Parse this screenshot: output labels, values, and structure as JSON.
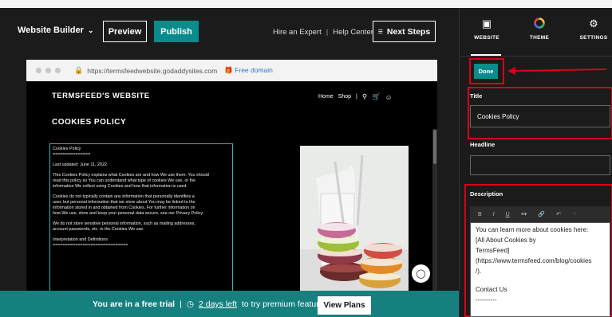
{
  "topbar": {
    "brand": "Website Builder",
    "preview_label": "Preview",
    "publish_label": "Publish",
    "hire_expert": "Hire an Expert",
    "help_center": "Help Center",
    "next_steps": "Next Steps"
  },
  "browser": {
    "url": "https://termsfeedwebsite.godaddysites.com",
    "free_domain": "Free domain"
  },
  "site": {
    "name": "TERMSFEED'S WEBSITE",
    "nav_home": "Home",
    "nav_shop": "Shop",
    "page_heading": "COOKIES POLICY",
    "policy_lines": [
      "Cookies Policy",
      "===============",
      "",
      "Last updated: June 11, 2022",
      "",
      "This Cookies Policy explains what Cookies are and how We use them. You should",
      "read this policy so You can understand what type of cookies We use, or the",
      "information We collect using Cookies and how that information is used.",
      "",
      "Cookies do not typically contain any information that personally identifies a",
      "user, but personal information that we store about You may be linked to the",
      "information stored in and obtained from Cookies. For further information on",
      "how We use, store and keep your personal data secure, see our Privacy Policy.",
      "",
      "We do not store sensitive personal information, such as mailing addresses,",
      "account passwords, etc. in the Cookies We use.",
      "",
      "Interpretation and Definitions",
      "=============================="
    ]
  },
  "trial": {
    "free_trial": "You are in a free trial",
    "days_left": "2 days left",
    "rest": "to try premium features",
    "view_plans": "View Plans"
  },
  "panel": {
    "tabs": [
      {
        "label": "WEBSITE",
        "icon": "browser-window-icon"
      },
      {
        "label": "THEME",
        "icon": "color-wheel-icon"
      },
      {
        "label": "SETTINGS",
        "icon": "gear-icon"
      }
    ],
    "done_label": "Done",
    "title_label": "Title",
    "title_value": "Cookies Policy",
    "headline_label": "Headline",
    "headline_value": "",
    "description_label": "Description",
    "toolbar": [
      "B",
      "I",
      "U",
      "list",
      "link",
      "undo",
      "redo"
    ],
    "description_lines": [
      "You can learn more about cookies here:",
      "[All About Cookies by",
      "TermsFeed]",
      "(https://www.termsfeed.com/blog/cookies",
      "/).",
      "",
      "Contact Us",
      "----------"
    ]
  },
  "colors": {
    "teal": "#0b8c8c",
    "trial_banner": "#16807f",
    "highlight_red": "#d8001a"
  }
}
